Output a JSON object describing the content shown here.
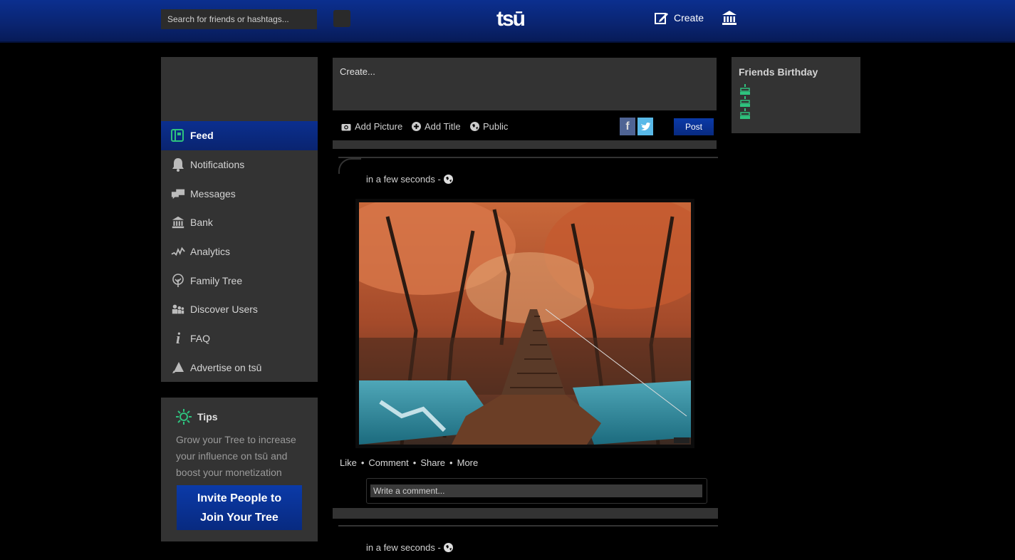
{
  "header": {
    "search_placeholder": "Search for friends or hashtags...",
    "logo": "tsū",
    "create_label": "Create"
  },
  "sidebar": {
    "items": [
      {
        "label": "Feed",
        "icon": "feed-icon",
        "active": true
      },
      {
        "label": "Notifications",
        "icon": "bell-icon"
      },
      {
        "label": "Messages",
        "icon": "messages-icon"
      },
      {
        "label": "Bank",
        "icon": "bank-icon"
      },
      {
        "label": "Analytics",
        "icon": "analytics-icon"
      },
      {
        "label": "Family Tree",
        "icon": "tree-icon"
      },
      {
        "label": "Discover Users",
        "icon": "users-icon"
      },
      {
        "label": "FAQ",
        "icon": "info-icon"
      },
      {
        "label": "Advertise on tsū",
        "icon": "megaphone-icon"
      }
    ]
  },
  "tips": {
    "title": "Tips",
    "text": "Grow your Tree to increase your influence on tsū and boost your monetization",
    "invite_line1": "Invite People to",
    "invite_line2": "Join Your Tree"
  },
  "composer": {
    "placeholder": "Create...",
    "add_picture": "Add Picture",
    "add_title": "Add Title",
    "visibility": "Public",
    "post_label": "Post"
  },
  "post": {
    "timestamp": "in a few seconds -",
    "actions": [
      "Like",
      "Comment",
      "Share",
      "More"
    ],
    "comment_placeholder": "Write a comment..."
  },
  "post2": {
    "timestamp": "in a few seconds -"
  },
  "birthday": {
    "title": "Friends Birthday"
  },
  "colors": {
    "header_blue": "#0a2470",
    "panel": "#333333",
    "accent_green": "#2ec27e"
  }
}
